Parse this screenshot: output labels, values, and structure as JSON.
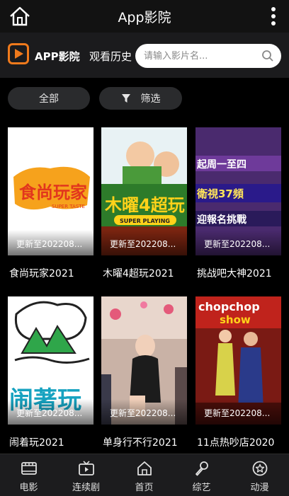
{
  "app": {
    "title": "App影院"
  },
  "header": {
    "logo_text": "APP影院",
    "history_label": "观看历史",
    "search_placeholder": "请输入影片名..."
  },
  "filters": {
    "all_label": "全部",
    "filter_label": "筛选"
  },
  "items": [
    {
      "name": "食尚玩家2021",
      "update": "更新至202208..."
    },
    {
      "name": "木曜4超玩2021",
      "update": "更新至202208..."
    },
    {
      "name": "挑战吧大神2021",
      "update": "更新至202208..."
    },
    {
      "name": "闹着玩2021",
      "update": "更新至202208..."
    },
    {
      "name": "单身行不行2021",
      "update": "更新至202208..."
    },
    {
      "name": "11点热吵店2020",
      "update": "更新至202208..."
    }
  ],
  "nav": [
    {
      "label": "电影",
      "icon": "film-icon"
    },
    {
      "label": "连续剧",
      "icon": "tv-icon"
    },
    {
      "label": "首页",
      "icon": "home-icon"
    },
    {
      "label": "综艺",
      "icon": "microphone-icon"
    },
    {
      "label": "动漫",
      "icon": "star-badge-icon"
    }
  ],
  "poster_text": {
    "p1_big": "食尚玩家",
    "p1_small": "SUPER TASTE",
    "p2_big": "木曜4超玩",
    "p2_small": "SUPER PLAYING",
    "p3_l1": "起周一至四",
    "p3_l2": "衛視37頻",
    "p3_l3": "迎報名挑戰",
    "p4_big": "闹著玩",
    "p6_l1": "chopchop",
    "p6_l2": "show"
  },
  "colors": {
    "accent": "#f07a1c",
    "topbar": "#121212",
    "subbar": "#1b1b1d",
    "pill": "#2a2b2d",
    "nav": "#1c1c1e"
  }
}
